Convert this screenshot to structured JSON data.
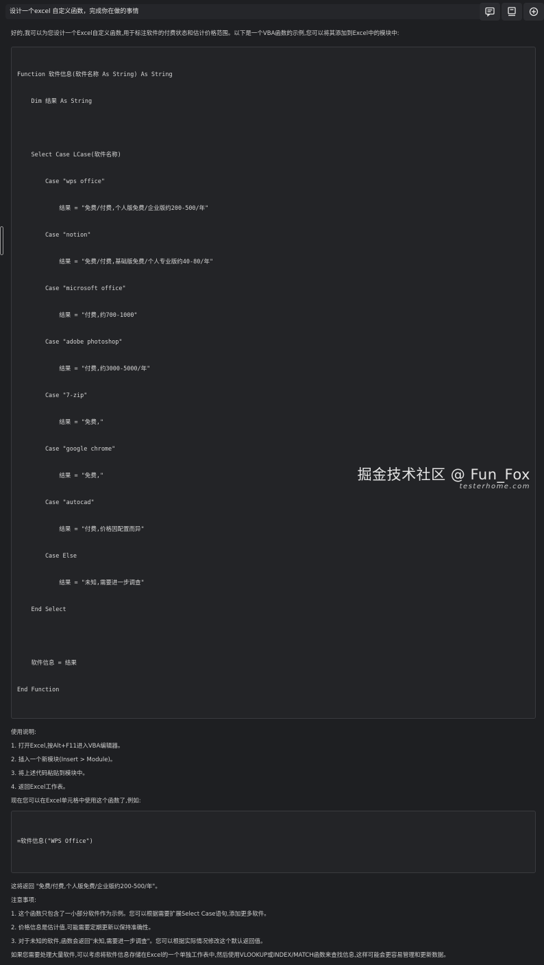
{
  "prompt": "设计一个excel 自定义函数，完成你在做的事情",
  "toolbar": {
    "icons": [
      "comment-icon",
      "document-icon",
      "plus-circle-icon"
    ]
  },
  "response": {
    "intro": "好的,我可以为您设计一个Excel自定义函数,用于标注软件的付费状态和估计价格范围。以下是一个VBA函数的示例,您可以将其添加到Excel中的模块中:",
    "code_lines": [
      "Function 软件信息(软件名称 As String) As String",
      "    Dim 结果 As String",
      "",
      "    Select Case LCase(软件名称)",
      "        Case \"wps office\"",
      "            结果 = \"免费/付费,个人版免费/企业版约200-500/年\"",
      "        Case \"notion\"",
      "            结果 = \"免费/付费,基础版免费/个人专业版约40-80/年\"",
      "        Case \"microsoft office\"",
      "            结果 = \"付费,约700-1000\"",
      "        Case \"adobe photoshop\"",
      "            结果 = \"付费,约3000-5000/年\"",
      "        Case \"7-zip\"",
      "            结果 = \"免费,\"",
      "        Case \"google chrome\"",
      "            结果 = \"免费,\"",
      "        Case \"autocad\"",
      "            结果 = \"付费,价格因配置而异\"",
      "        Case Else",
      "            结果 = \"未知,需要进一步调查\"",
      "    End Select",
      "",
      "    软件信息 = 结果",
      "End Function"
    ],
    "usage_title": "使用说明:",
    "steps": [
      "1. 打开Excel,按Alt+F11进入VBA编辑器。",
      "2. 插入一个新模块(Insert > Module)。",
      "3. 将上述代码粘贴到模块中。",
      "4. 返回Excel工作表。"
    ],
    "example_intro": "现在您可以在Excel单元格中使用这个函数了,例如:",
    "example_code": "=软件信息(\"WPS Office\")",
    "example_result": "这将返回 \"免费/付费,个人版免费/企业版约200-500/年\"。",
    "notes_title": "注意事项:",
    "notes": [
      "1. 这个函数只包含了一小部分软件作为示例。您可以根据需要扩展Select Case语句,添加更多软件。",
      "2. 价格信息是估计值,可能需要定期更新以保持准确性。",
      "3. 对于未知的软件,函数会返回\"未知,需要进一步调查\"。您可以根据实际情况修改这个默认返回值。"
    ],
    "closing": "如果您需要处理大量软件,可以考虑将软件信息存储在Excel的一个单独工作表中,然后使用VLOOKUP或INDEX/MATCH函数来查找信息,这样可能会更容易管理和更新数据。"
  },
  "watermark": {
    "main": "掘金技术社区 @ Fun_Fox",
    "sub": "testerhome.com"
  }
}
